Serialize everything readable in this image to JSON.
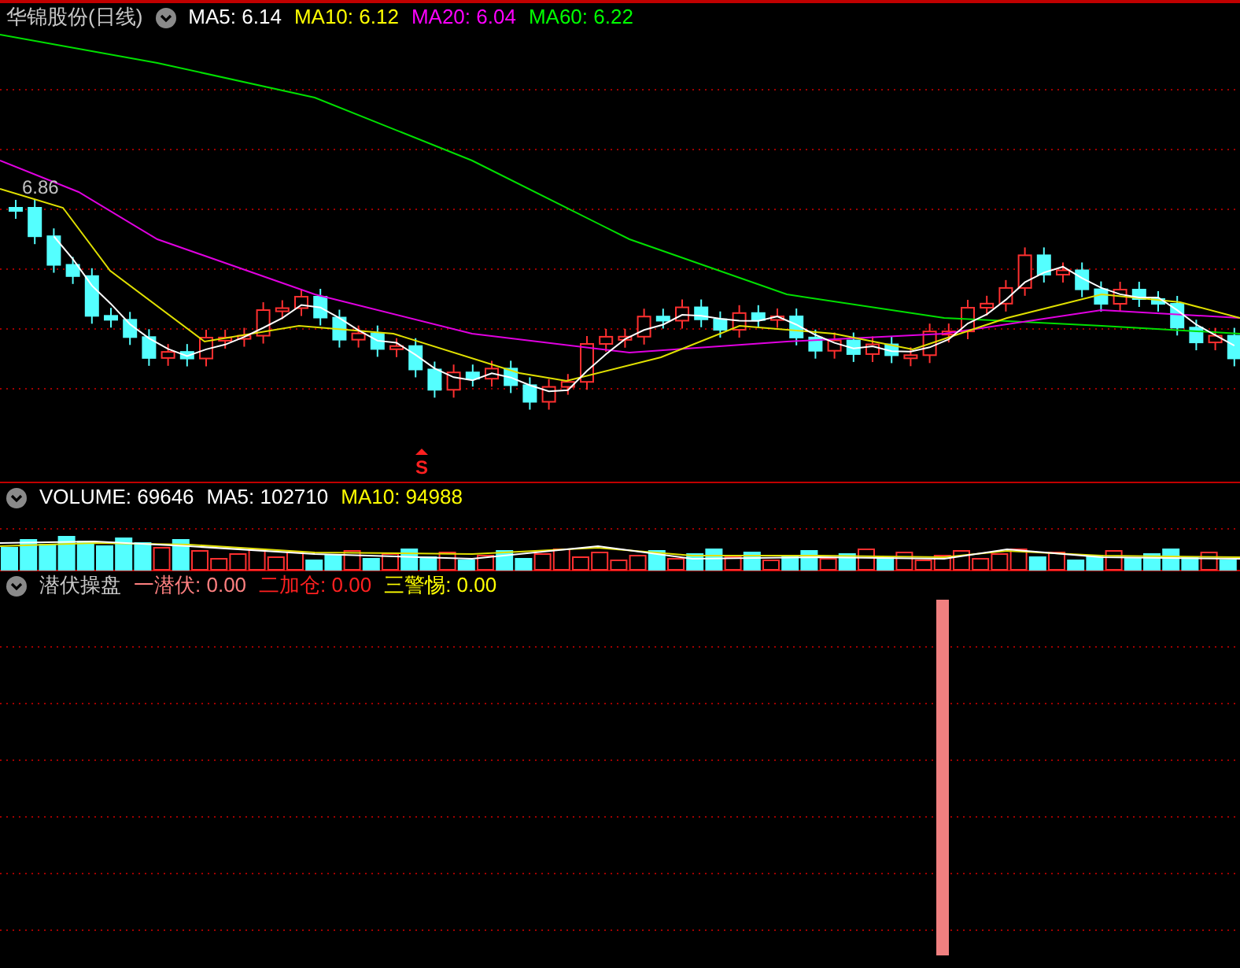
{
  "main_panel": {
    "title": "华锦股份(日线)",
    "indicators": [
      {
        "label": "MA5: 6.14",
        "color": "#ffffff"
      },
      {
        "label": "MA10: 6.12",
        "color": "#ffff00"
      },
      {
        "label": "MA20: 6.04",
        "color": "#ff00ff"
      },
      {
        "label": "MA60: 6.22",
        "color": "#00ff00"
      }
    ],
    "price_label": "6.86",
    "signal_mark": "S"
  },
  "volume_panel": {
    "indicators": [
      {
        "label": "VOLUME: 69646",
        "color": "#ffffff"
      },
      {
        "label": "MA5: 102710",
        "color": "#ffffff"
      },
      {
        "label": "MA10: 94988",
        "color": "#ffff00"
      }
    ]
  },
  "indicator_panel": {
    "title": "潜伏操盘",
    "indicators": [
      {
        "label": "一潜伏: 0.00",
        "color": "#ff8080"
      },
      {
        "label": "二加仓: 0.00",
        "color": "#ff2020"
      },
      {
        "label": "三警惕: 0.00",
        "color": "#ffff00"
      }
    ]
  }
}
